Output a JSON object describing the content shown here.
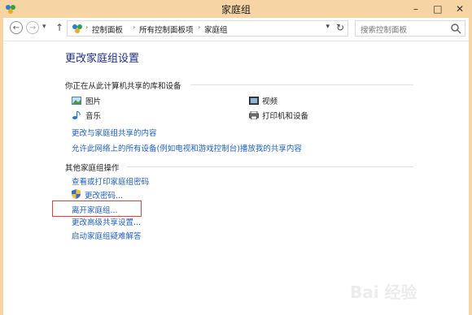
{
  "window": {
    "title": "家庭组",
    "controls": [
      "–",
      "□",
      "✕"
    ]
  },
  "nav": {
    "back_icon": "back-arrow-icon",
    "forward_icon": "forward-arrow-icon",
    "breadcrumb": [
      "控制面板",
      "所有控制面板项",
      "家庭组"
    ],
    "search_placeholder": "搜索控制面板"
  },
  "main": {
    "heading": "更改家庭组设置",
    "shared_section": {
      "title": "你正在从此计算机共享的库和设备",
      "items": [
        {
          "label": "图片",
          "icon": "pictures-icon"
        },
        {
          "label": "视频",
          "icon": "video-icon"
        },
        {
          "label": "音乐",
          "icon": "music-icon"
        },
        {
          "label": "打印机和设备",
          "icon": "printer-icon"
        }
      ],
      "links": [
        "更改与家庭组共享的内容",
        "允许此网络上的所有设备(例如电视和游戏控制台)播放我的共享内容"
      ]
    },
    "other_section": {
      "title": "其他家庭组操作",
      "links": [
        "查看或打印家庭组密码",
        "更改密码...",
        "离开家庭组...",
        "更改高级共享设置...",
        "启动家庭组疑难解答"
      ]
    }
  },
  "watermark": "Bai 经验",
  "colors": {
    "title_bar": "#f6d4a4",
    "link": "#1f5fbf",
    "heading": "#1e3287",
    "highlight": "#e53e3e"
  }
}
